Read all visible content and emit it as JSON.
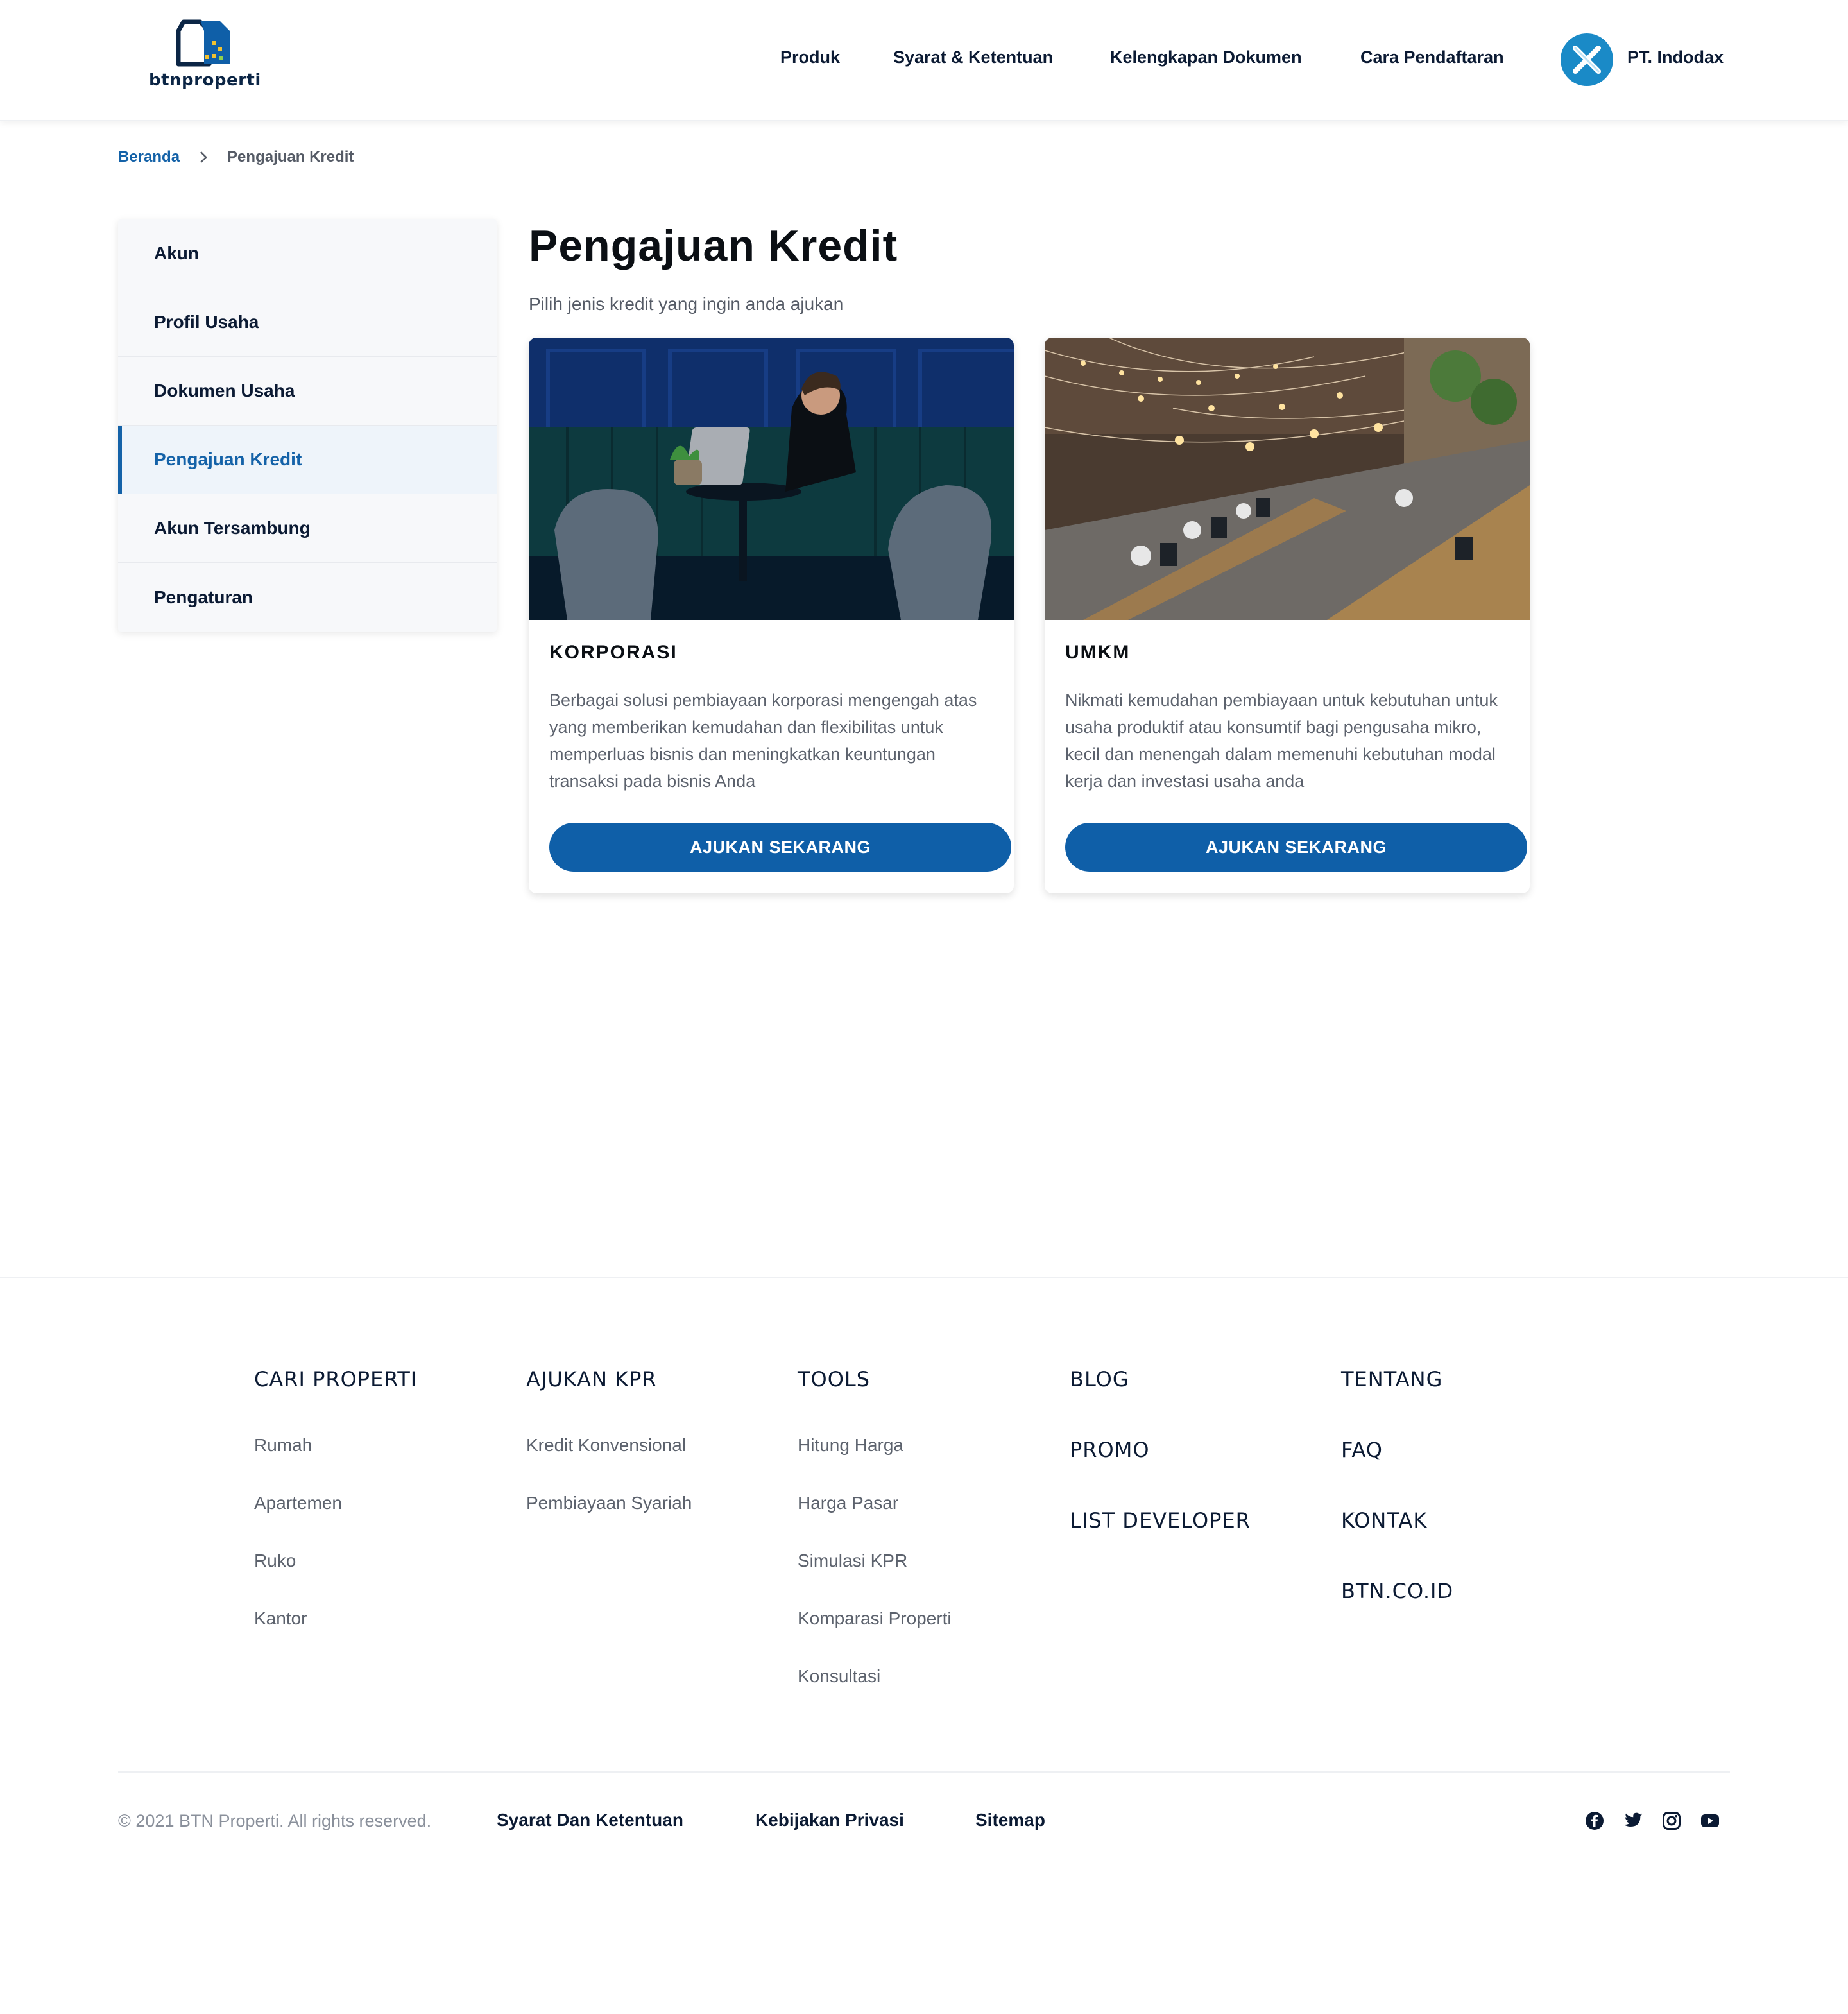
{
  "header": {
    "logo_text": "btnproperti",
    "nav": [
      "Produk",
      "Syarat & Ketentuan",
      "Kelengkapan Dokumen",
      "Cara Pendaftaran"
    ],
    "user_name": "PT. Indodax"
  },
  "breadcrumb": {
    "home": "Beranda",
    "current": "Pengajuan Kredit"
  },
  "sidebar": {
    "items": [
      {
        "label": "Akun"
      },
      {
        "label": "Profil Usaha"
      },
      {
        "label": "Dokumen Usaha"
      },
      {
        "label": "Pengajuan Kredit",
        "active": true
      },
      {
        "label": "Akun Tersambung"
      },
      {
        "label": "Pengaturan"
      }
    ]
  },
  "main": {
    "title": "Pengajuan Kredit",
    "subtitle": "Pilih jenis kredit yang ingin anda ajukan",
    "cards": [
      {
        "title": "KORPORASI",
        "description": "Berbagai solusi pembiayaan korporasi mengengah atas yang memberikan kemudahan dan flexibilitas untuk memperluas bisnis dan meningkatkan keuntungan transaksi pada bisnis Anda",
        "button": "AJUKAN SEKARANG"
      },
      {
        "title": "UMKM",
        "description": "Nikmati kemudahan pembiayaan untuk kebutuhan untuk usaha produktif atau konsumtif bagi pengusaha mikro, kecil dan menengah dalam memenuhi kebutuhan modal kerja dan investasi usaha anda",
        "button": "AJUKAN SEKARANG"
      }
    ]
  },
  "footer": {
    "columns": [
      {
        "heading": "CARI PROPERTI",
        "links": [
          "Rumah",
          "Apartemen",
          "Ruko",
          "Kantor"
        ]
      },
      {
        "heading": "AJUKAN KPR",
        "links": [
          "Kredit Konvensional",
          "Pembiayaan Syariah"
        ]
      },
      {
        "heading": "TOOLS",
        "links": [
          "Hitung Harga",
          "Harga Pasar",
          "Simulasi KPR",
          "Komparasi Properti",
          "Konsultasi"
        ]
      },
      {
        "links": [
          "BLOG",
          "PROMO",
          "LIST DEVELOPER"
        ]
      },
      {
        "links": [
          "TENTANG",
          "FAQ",
          "KONTAK",
          "BTN.CO.ID"
        ]
      }
    ],
    "copyright": "© 2021 BTN Properti. All rights reserved.",
    "bottom_links": [
      "Syarat Dan Ketentuan",
      "Kebijakan Privasi",
      "Sitemap"
    ],
    "social": [
      "facebook-icon",
      "twitter-icon",
      "instagram-icon",
      "youtube-icon"
    ]
  },
  "colors": {
    "brand": "#0f5fa8",
    "active": "#1462a8",
    "avatar": "#1a8ac7"
  }
}
